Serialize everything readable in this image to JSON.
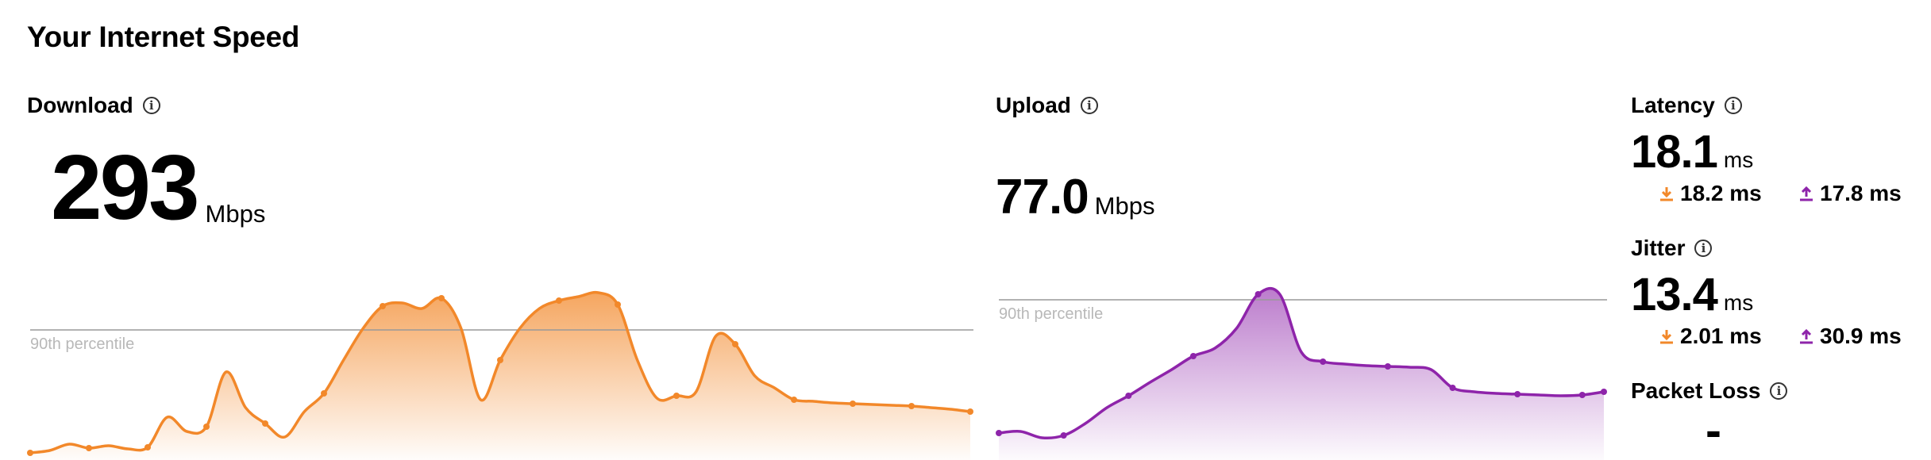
{
  "page": {
    "title": "Your Internet Speed"
  },
  "download": {
    "label": "Download",
    "value": "293",
    "unit": "Mbps",
    "percentile_label": "90th percentile",
    "color": "#f2882a",
    "series": [
      3,
      6,
      14,
      9,
      12,
      8,
      10,
      48,
      30,
      36,
      105,
      60,
      40,
      23,
      55,
      78,
      120,
      160,
      188,
      192,
      185,
      198,
      160,
      70,
      120,
      160,
      185,
      195,
      200,
      205,
      190,
      120,
      72,
      75,
      80,
      150,
      140,
      100,
      85,
      70,
      68,
      66,
      65,
      64,
      63,
      62,
      60,
      58,
      55
    ]
  },
  "upload": {
    "label": "Upload",
    "value": "77.0",
    "unit": "Mbps",
    "percentile_label": "90th percentile",
    "color": "#8e24aa",
    "series": [
      28,
      30,
      22,
      25,
      40,
      60,
      75,
      92,
      108,
      125,
      135,
      160,
      203,
      203,
      130,
      118,
      115,
      113,
      112,
      111,
      108,
      85,
      80,
      78,
      77,
      76,
      75,
      76,
      80
    ]
  },
  "latency": {
    "label": "Latency",
    "value": "18.1",
    "unit": "ms",
    "down_value": "18.2 ms",
    "up_value": "17.8 ms"
  },
  "jitter": {
    "label": "Jitter",
    "value": "13.4",
    "unit": "ms",
    "down_value": "2.01 ms",
    "up_value": "30.9 ms"
  },
  "packet_loss": {
    "label": "Packet Loss",
    "value": "-"
  },
  "icons": {
    "info": "info-icon",
    "down_arrow": "download-arrow-icon",
    "up_arrow": "upload-arrow-icon"
  },
  "colors": {
    "download_accent": "#f2882a",
    "upload_accent": "#8e24aa"
  }
}
